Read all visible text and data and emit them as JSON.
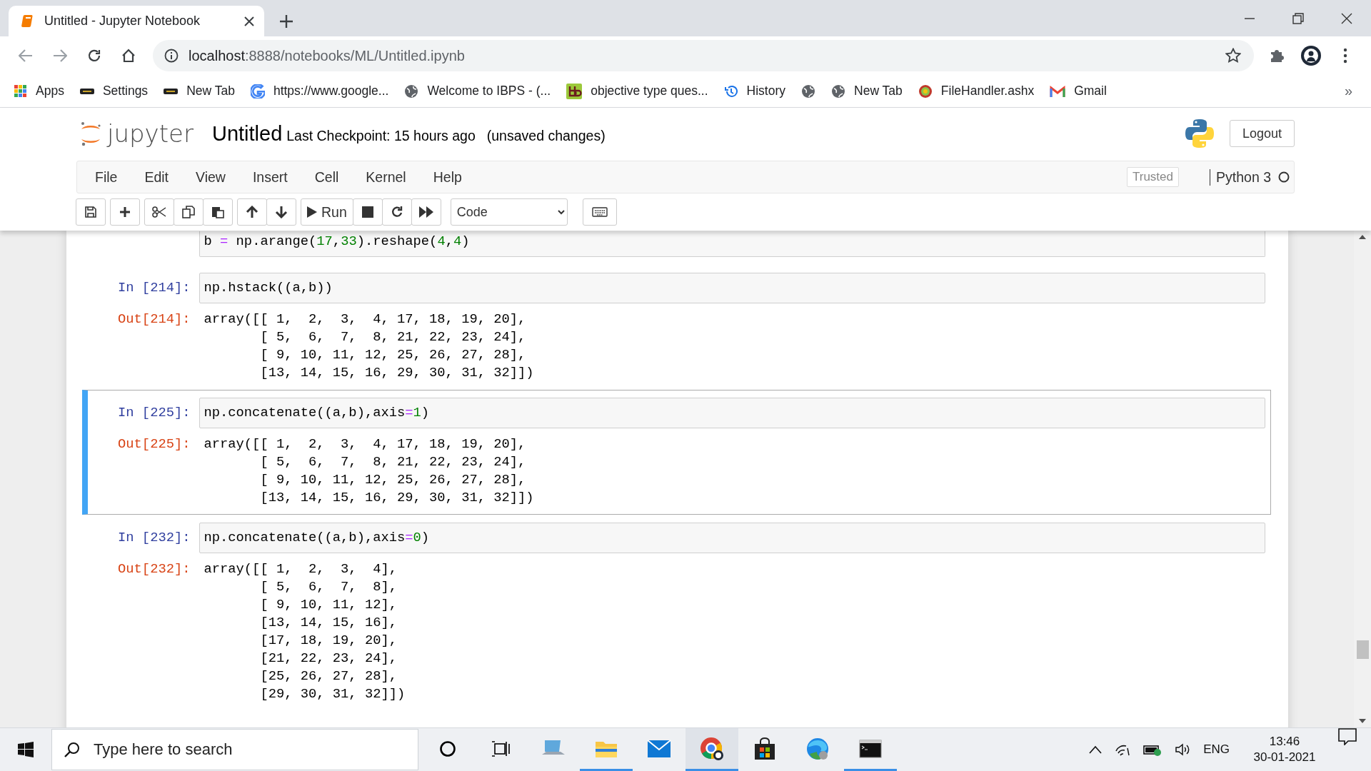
{
  "browser": {
    "tab": {
      "title": "Untitled - Jupyter Notebook",
      "selected": true
    },
    "address": {
      "host": "localhost",
      "path": ":8888/notebooks/ML/Untitled.ipynb"
    },
    "bookmarks": [
      {
        "label": "Apps",
        "kind": "apps"
      },
      {
        "label": "Settings",
        "kind": "site"
      },
      {
        "label": "New Tab",
        "kind": "site"
      },
      {
        "label": "https://www.google...",
        "kind": "google"
      },
      {
        "label": "Welcome to IBPS - (...",
        "kind": "globe"
      },
      {
        "label": "objective type ques...",
        "kind": "bb"
      },
      {
        "label": "History",
        "kind": "history"
      },
      {
        "kind": "globe"
      },
      {
        "label": "New Tab",
        "kind": "globe"
      },
      {
        "label": "FileHandler.ashx",
        "kind": "seal"
      },
      {
        "label": "Gmail",
        "kind": "gmail"
      }
    ],
    "more": "»"
  },
  "notebook": {
    "logo_text": "jupyter",
    "title": "Untitled",
    "checkpoint": "Last Checkpoint: 15 hours ago",
    "status": "(unsaved changes)",
    "logout": "Logout",
    "menus": [
      "File",
      "Edit",
      "View",
      "Insert",
      "Cell",
      "Kernel",
      "Help"
    ],
    "trusted": "Trusted",
    "kernel": "Python 3",
    "kernel_busy": false,
    "toolbar": {
      "run": "Run",
      "cell_type": "Code"
    }
  },
  "cells": [
    {
      "selected": false,
      "code": [
        [
          {
            "t": "b ",
            "kind": "plain"
          },
          {
            "t": "=",
            "kind": "op"
          },
          {
            "t": " np.arange(",
            "kind": "plain"
          },
          {
            "t": "17",
            "kind": "num"
          },
          {
            "t": ",",
            "kind": "plain"
          },
          {
            "t": "33",
            "kind": "num"
          },
          {
            "t": ").reshape(",
            "kind": "plain"
          },
          {
            "t": "4",
            "kind": "num"
          },
          {
            "t": ",",
            "kind": "plain"
          },
          {
            "t": "4",
            "kind": "num"
          },
          {
            "t": ")",
            "kind": "plain"
          }
        ]
      ]
    },
    {
      "selected": false,
      "prompt": "In [214]:",
      "code": [
        [
          {
            "t": "np.hstack((a,b))",
            "kind": "plain"
          }
        ]
      ],
      "out_prompt": "Out[214]:",
      "output": [
        "array([[ 1,  2,  3,  4, 17, 18, 19, 20],",
        "       [ 5,  6,  7,  8, 21, 22, 23, 24],",
        "       [ 9, 10, 11, 12, 25, 26, 27, 28],",
        "       [13, 14, 15, 16, 29, 30, 31, 32]])"
      ]
    },
    {
      "selected": true,
      "prompt": "In [225]:",
      "code": [
        [
          {
            "t": "np.concatenate((a,b),axis",
            "kind": "plain"
          },
          {
            "t": "=",
            "kind": "op"
          },
          {
            "t": "1",
            "kind": "num"
          },
          {
            "t": ")",
            "kind": "plain"
          }
        ]
      ],
      "out_prompt": "Out[225]:",
      "output": [
        "array([[ 1,  2,  3,  4, 17, 18, 19, 20],",
        "       [ 5,  6,  7,  8, 21, 22, 23, 24],",
        "       [ 9, 10, 11, 12, 25, 26, 27, 28],",
        "       [13, 14, 15, 16, 29, 30, 31, 32]])"
      ]
    },
    {
      "selected": false,
      "prompt": "In [232]:",
      "code": [
        [
          {
            "t": "np.concatenate((a,b),axis",
            "kind": "plain"
          },
          {
            "t": "=",
            "kind": "op"
          },
          {
            "t": "0",
            "kind": "num"
          },
          {
            "t": ")",
            "kind": "plain"
          }
        ]
      ],
      "out_prompt": "Out[232]:",
      "output": [
        "array([[ 1,  2,  3,  4],",
        "       [ 5,  6,  7,  8],",
        "       [ 9, 10, 11, 12],",
        "       [13, 14, 15, 16],",
        "       [17, 18, 19, 20],",
        "       [21, 22, 23, 24],",
        "       [25, 26, 27, 28],",
        "       [29, 30, 31, 32]])"
      ]
    }
  ],
  "taskbar": {
    "search": {
      "placeholder": "Type here to search"
    },
    "apps": [
      {
        "kind": "cortana",
        "active": false,
        "focused": false
      },
      {
        "kind": "taskview",
        "active": false,
        "focused": false
      },
      {
        "kind": "computer",
        "active": false,
        "focused": false
      },
      {
        "kind": "explorer",
        "active": true,
        "focused": false
      },
      {
        "kind": "mail",
        "active": false,
        "focused": false
      },
      {
        "kind": "chrome",
        "active": true,
        "focused": true
      },
      {
        "kind": "store",
        "active": false,
        "focused": false
      },
      {
        "kind": "edge",
        "active": false,
        "focused": false
      },
      {
        "kind": "terminal",
        "active": true,
        "focused": false
      }
    ],
    "lang": "ENG",
    "time": "13:46",
    "date": "30-01-2021"
  }
}
